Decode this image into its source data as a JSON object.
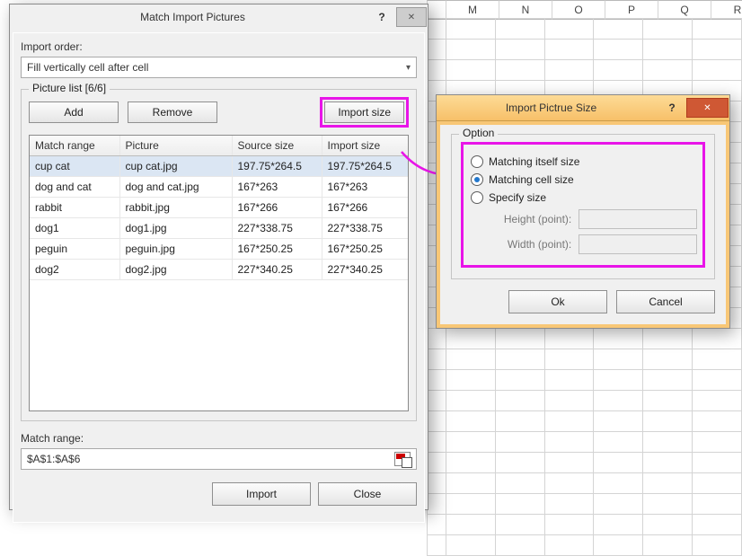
{
  "sheet_cols": [
    "M",
    "N",
    "O",
    "P",
    "Q",
    "R"
  ],
  "main_dialog": {
    "title": "Match Import Pictures",
    "import_order_label": "Import order:",
    "import_order_value": "Fill vertically cell after cell",
    "picture_list_legend": "Picture list [6/6]",
    "add_btn": "Add",
    "remove_btn": "Remove",
    "import_size_btn": "Import size",
    "columns": [
      "Match range",
      "Picture",
      "Source size",
      "Import size"
    ],
    "rows": [
      {
        "match": "cup cat",
        "pic": "cup cat.jpg",
        "src": "197.75*264.5",
        "imp": "197.75*264.5",
        "selected": true
      },
      {
        "match": "dog and cat",
        "pic": "dog and cat.jpg",
        "src": "167*263",
        "imp": "167*263",
        "selected": false
      },
      {
        "match": "rabbit",
        "pic": "rabbit.jpg",
        "src": "167*266",
        "imp": "167*266",
        "selected": false
      },
      {
        "match": "dog1",
        "pic": "dog1.jpg",
        "src": "227*338.75",
        "imp": "227*338.75",
        "selected": false
      },
      {
        "match": "peguin",
        "pic": "peguin.jpg",
        "src": "167*250.25",
        "imp": "167*250.25",
        "selected": false
      },
      {
        "match": "dog2",
        "pic": "dog2.jpg",
        "src": "227*340.25",
        "imp": "227*340.25",
        "selected": false
      }
    ],
    "match_range_label": "Match range:",
    "match_range_value": "$A$1:$A$6",
    "import_btn": "Import",
    "close_btn": "Close"
  },
  "opt_dialog": {
    "title": "Import Pictrue Size",
    "legend": "Option",
    "r1": "Matching itself size",
    "r2": "Matching cell size",
    "r3": "Specify size",
    "height_label": "Height (point):",
    "width_label": "Width (point):",
    "ok": "Ok",
    "cancel": "Cancel"
  }
}
